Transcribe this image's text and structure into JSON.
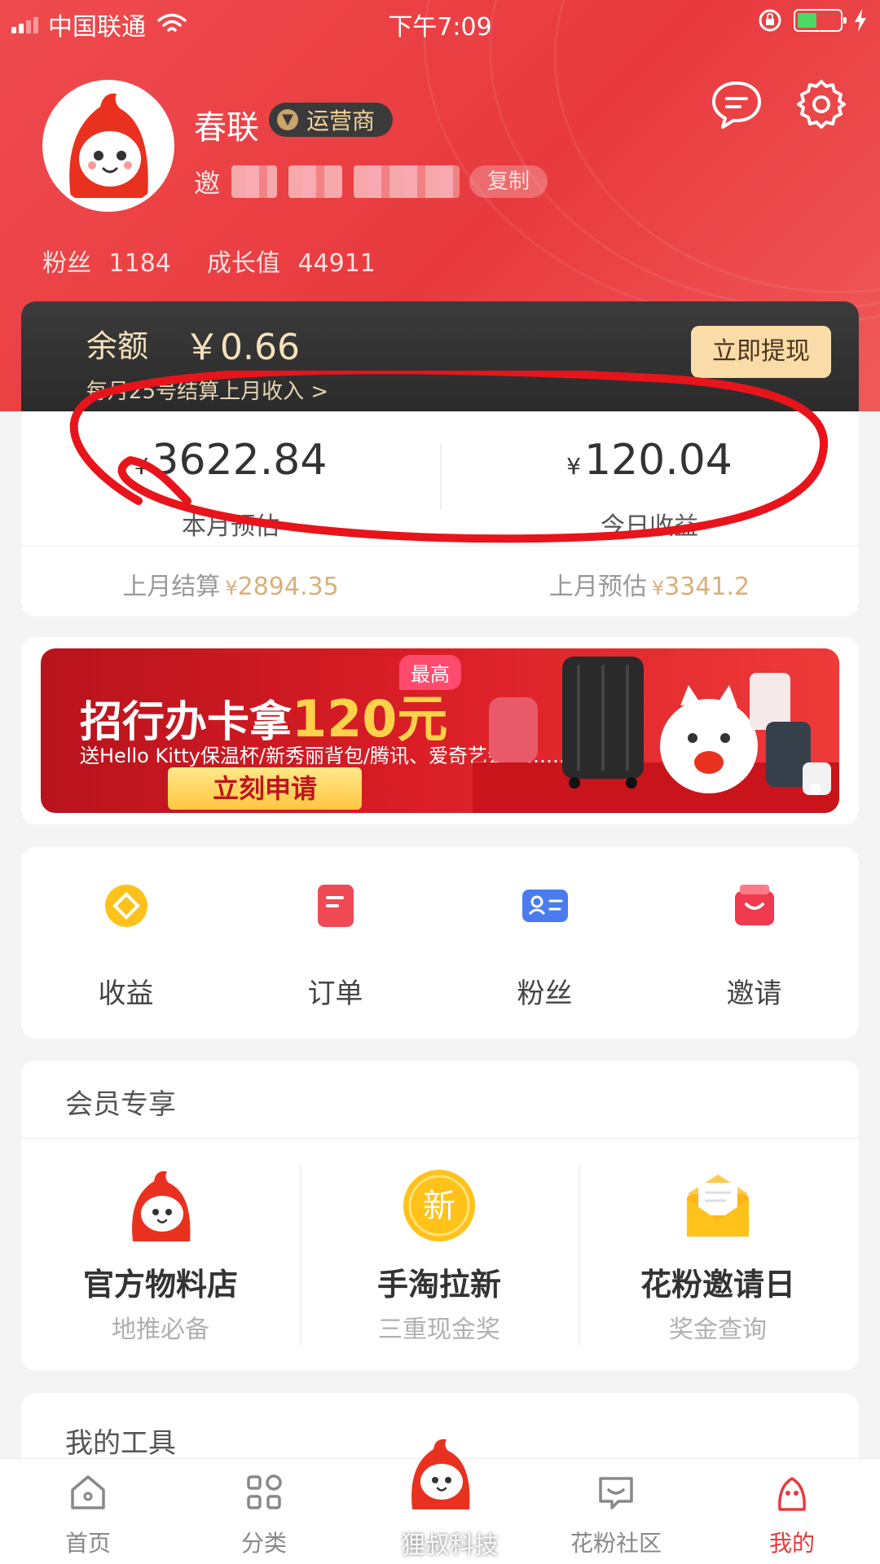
{
  "status_bar": {
    "carrier": "中国联通",
    "time": "下午7:09"
  },
  "profile": {
    "name": "春联",
    "role": "运营商",
    "invite_prefix": "邀",
    "copy_label": "复制",
    "fans_label": "粉丝",
    "fans_value": "1184",
    "growth_label": "成长值",
    "growth_value": "44911"
  },
  "balance": {
    "label": "余额",
    "amount": "￥0.66",
    "note": "每月25号结算上月收入 >",
    "withdraw_label": "立即提现"
  },
  "earnings": {
    "currency": "¥",
    "month_estimate_value": "3622.84",
    "month_estimate_label": "本月预估",
    "today_value": "120.04",
    "today_label": "今日收益",
    "last_month_settled_label": "上月结算",
    "last_month_settled_value": "2894.35",
    "last_month_estimate_label": "上月预估",
    "last_month_estimate_value": "3341.2"
  },
  "banner": {
    "title_prefix": "招行办卡拿",
    "title_amount": "120元",
    "tag": "最高",
    "subtitle": "送Hello Kitty保温杯/新秀丽背包/腾讯、爱奇艺会员……",
    "button_label": "立刻申请"
  },
  "quick_actions": [
    {
      "label": "收益",
      "icon": "earnings-icon"
    },
    {
      "label": "订单",
      "icon": "orders-icon"
    },
    {
      "label": "粉丝",
      "icon": "fans-icon"
    },
    {
      "label": "邀请",
      "icon": "invite-icon"
    }
  ],
  "member_section": {
    "title": "会员专享",
    "items": [
      {
        "title": "官方物料店",
        "subtitle": "地推必备",
        "icon": "mascot-icon"
      },
      {
        "title": "手淘拉新",
        "subtitle": "三重现金奖",
        "icon": "new-badge-icon",
        "badge_text": "新"
      },
      {
        "title": "花粉邀请日",
        "subtitle": "奖金查询",
        "icon": "envelope-icon"
      }
    ]
  },
  "tools_section": {
    "title": "我的工具"
  },
  "tab_bar": {
    "tabs": [
      {
        "label": "首页",
        "icon": "home-icon"
      },
      {
        "label": "分类",
        "icon": "category-icon"
      },
      {
        "label": "",
        "icon": "mascot-center-icon"
      },
      {
        "label": "花粉社区",
        "icon": "community-icon"
      },
      {
        "label": "我的",
        "icon": "profile-icon",
        "active": true
      }
    ]
  },
  "watermark": "狸叔科技",
  "colors": {
    "brand_red": "#e83a3e",
    "gold": "#d9b07a",
    "dark_card": "#2f2f2f",
    "annotation_red": "#e8141c"
  }
}
